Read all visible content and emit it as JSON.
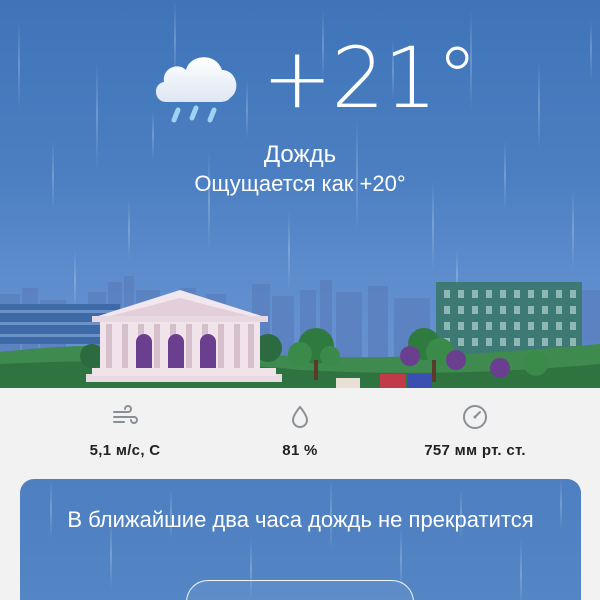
{
  "current": {
    "temperature": "+21°",
    "condition": "Дождь",
    "feels_like": "Ощущается как +20°",
    "icon": "cloud-rain-icon"
  },
  "details": {
    "wind": {
      "icon": "wind-icon",
      "value": "5,1 м/с, С"
    },
    "humidity": {
      "icon": "humidity-drop-icon",
      "value": "81 %"
    },
    "pressure": {
      "icon": "pressure-gauge-icon",
      "value": "757 мм рт. ст."
    }
  },
  "nowcast": {
    "text": "В ближайшие два часа дождь не прекратится"
  },
  "colors": {
    "sky_top": "#3f74b9",
    "sky_bottom": "#6a94cf",
    "details_bg": "#f2f2f2",
    "card_bg": "#4d7fc1"
  }
}
